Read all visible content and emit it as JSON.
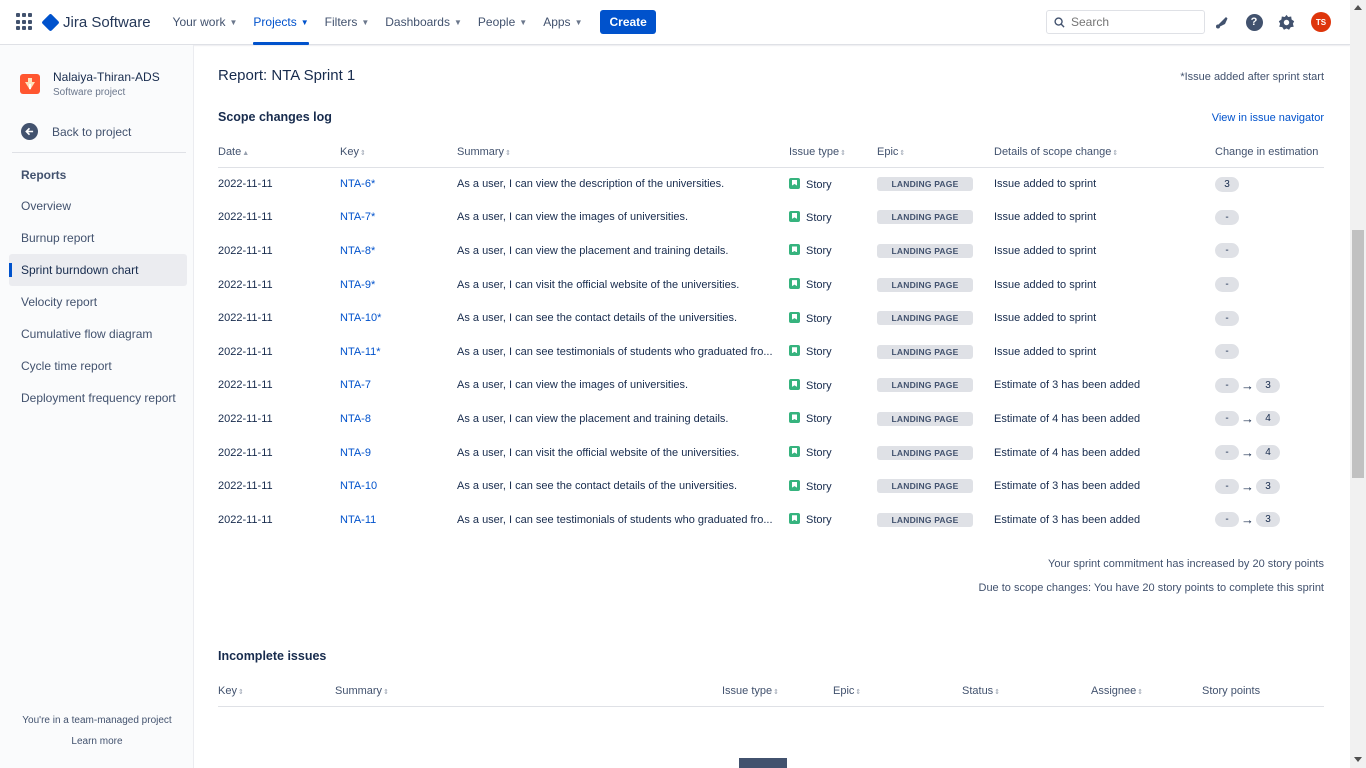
{
  "topnav": {
    "logo_text": "Jira Software",
    "items": [
      {
        "label": "Your work",
        "active": false
      },
      {
        "label": "Projects",
        "active": true
      },
      {
        "label": "Filters",
        "active": false
      },
      {
        "label": "Dashboards",
        "active": false
      },
      {
        "label": "People",
        "active": false
      },
      {
        "label": "Apps",
        "active": false
      }
    ],
    "create_label": "Create",
    "search_placeholder": "Search",
    "avatar_initials": "TS"
  },
  "sidebar": {
    "project_name": "Nalaiya-Thiran-ADS",
    "project_type": "Software project",
    "back_label": "Back to project",
    "reports_heading": "Reports",
    "items": [
      {
        "label": "Overview",
        "active": false
      },
      {
        "label": "Burnup report",
        "active": false
      },
      {
        "label": "Sprint burndown chart",
        "active": true
      },
      {
        "label": "Velocity report",
        "active": false
      },
      {
        "label": "Cumulative flow diagram",
        "active": false
      },
      {
        "label": "Cycle time report",
        "active": false
      },
      {
        "label": "Deployment frequency report",
        "active": false
      }
    ],
    "footer_note": "You're in a team-managed project",
    "footer_link": "Learn more"
  },
  "report": {
    "title": "Report: NTA Sprint 1",
    "note": "*Issue added after sprint start"
  },
  "scope_log": {
    "title": "Scope changes log",
    "view_link": "View in issue navigator",
    "columns": [
      "Date",
      "Key",
      "Summary",
      "Issue type",
      "Epic",
      "Details of scope change",
      "Change in estimation"
    ],
    "rows": [
      {
        "date": "2022-11-11",
        "key": "NTA-6*",
        "summary": "As a user, I can view the description of the universities.",
        "type": "Story",
        "epic": "LANDING PAGE",
        "details": "Issue added to sprint",
        "from": "3",
        "to": ""
      },
      {
        "date": "2022-11-11",
        "key": "NTA-7*",
        "summary": "As a user, I can view the images of universities.",
        "type": "Story",
        "epic": "LANDING PAGE",
        "details": "Issue added to sprint",
        "from": "-",
        "to": ""
      },
      {
        "date": "2022-11-11",
        "key": "NTA-8*",
        "summary": "As a user, I can view the placement and training details.",
        "type": "Story",
        "epic": "LANDING PAGE",
        "details": "Issue added to sprint",
        "from": "-",
        "to": ""
      },
      {
        "date": "2022-11-11",
        "key": "NTA-9*",
        "summary": "As a user, I can visit the official website of the universities.",
        "type": "Story",
        "epic": "LANDING PAGE",
        "details": "Issue added to sprint",
        "from": "-",
        "to": ""
      },
      {
        "date": "2022-11-11",
        "key": "NTA-10*",
        "summary": "As a user, I can see the contact details of the universities.",
        "type": "Story",
        "epic": "LANDING PAGE",
        "details": "Issue added to sprint",
        "from": "-",
        "to": ""
      },
      {
        "date": "2022-11-11",
        "key": "NTA-11*",
        "summary": "As a user, I can see testimonials of students who graduated fro...",
        "type": "Story",
        "epic": "LANDING PAGE",
        "details": "Issue added to sprint",
        "from": "-",
        "to": ""
      },
      {
        "date": "2022-11-11",
        "key": "NTA-7",
        "summary": "As a user, I can view the images of universities.",
        "type": "Story",
        "epic": "LANDING PAGE",
        "details": "Estimate of 3 has been added",
        "from": "-",
        "to": "3"
      },
      {
        "date": "2022-11-11",
        "key": "NTA-8",
        "summary": "As a user, I can view the placement and training details.",
        "type": "Story",
        "epic": "LANDING PAGE",
        "details": "Estimate of 4 has been added",
        "from": "-",
        "to": "4"
      },
      {
        "date": "2022-11-11",
        "key": "NTA-9",
        "summary": "As a user, I can visit the official website of the universities.",
        "type": "Story",
        "epic": "LANDING PAGE",
        "details": "Estimate of 4 has been added",
        "from": "-",
        "to": "4"
      },
      {
        "date": "2022-11-11",
        "key": "NTA-10",
        "summary": "As a user, I can see the contact details of the universities.",
        "type": "Story",
        "epic": "LANDING PAGE",
        "details": "Estimate of 3 has been added",
        "from": "-",
        "to": "3"
      },
      {
        "date": "2022-11-11",
        "key": "NTA-11",
        "summary": "As a user, I can see testimonials of students who graduated fro...",
        "type": "Story",
        "epic": "LANDING PAGE",
        "details": "Estimate of 3 has been added",
        "from": "-",
        "to": "3"
      }
    ],
    "commitment_note": "Your sprint commitment has increased by 20 story points",
    "scope_note": "Due to scope changes: You have 20 story points to complete this sprint"
  },
  "incomplete": {
    "title": "Incomplete issues",
    "columns": [
      "Key",
      "Summary",
      "Issue type",
      "Epic",
      "Status",
      "Assignee",
      "Story points"
    ]
  },
  "icons": {
    "app_switcher": "grid-icon",
    "notifications": "bell-icon",
    "help": "help-icon",
    "settings": "gear-icon",
    "back": "arrow-left-icon",
    "search": "search-icon"
  },
  "colors": {
    "brand": "#0052cc",
    "story": "#36b37e",
    "avatar": "#de350b",
    "project_icon": "#ff5630"
  }
}
